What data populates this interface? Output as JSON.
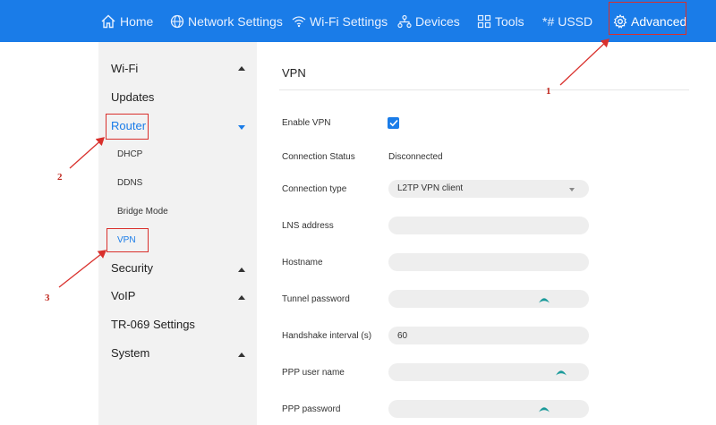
{
  "nav": {
    "items": [
      {
        "label": "Home",
        "icon": "home-icon"
      },
      {
        "label": "Network Settings",
        "icon": "globe-icon"
      },
      {
        "label": "Wi-Fi Settings",
        "icon": "wifi-icon"
      },
      {
        "label": "Devices",
        "icon": "devices-icon"
      },
      {
        "label": "Tools",
        "icon": "tools-icon"
      },
      {
        "label": "USSD",
        "prefix": "*#",
        "icon": "ussd-icon"
      },
      {
        "label": "Advanced",
        "icon": "gear-icon",
        "active": true
      }
    ]
  },
  "sidebar": {
    "items": [
      {
        "label": "Wi-Fi",
        "caret": "up"
      },
      {
        "label": "Updates"
      },
      {
        "label": "Router",
        "caret": "down",
        "highlighted": true
      },
      {
        "label": "DHCP"
      },
      {
        "label": "DDNS"
      },
      {
        "label": "Bridge Mode"
      },
      {
        "label": "VPN",
        "selected": true
      },
      {
        "label": "Security",
        "caret": "up"
      },
      {
        "label": "VoIP",
        "caret": "up"
      },
      {
        "label": "TR-069 Settings"
      },
      {
        "label": "System",
        "caret": "up"
      }
    ]
  },
  "panel": {
    "title": "VPN",
    "fields": {
      "enable_vpn": {
        "label": "Enable VPN",
        "checked": true
      },
      "connection_status": {
        "label": "Connection Status",
        "value": "Disconnected"
      },
      "connection_type": {
        "label": "Connection type",
        "value": "L2TP VPN client"
      },
      "lns_address": {
        "label": "LNS address",
        "value": ""
      },
      "hostname": {
        "label": "Hostname",
        "value": ""
      },
      "tunnel_password": {
        "label": "Tunnel password",
        "value": ""
      },
      "handshake_interval": {
        "label": "Handshake interval (s)",
        "value": "60"
      },
      "ppp_user_name": {
        "label": "PPP user name",
        "value": ""
      },
      "ppp_password": {
        "label": "PPP password",
        "value": ""
      }
    }
  },
  "annotations": {
    "one": "1",
    "two": "2",
    "three": "3"
  },
  "colors": {
    "accent": "#1a7ce8",
    "annotation": "#d9302c",
    "eye": "#1a9a9a"
  }
}
